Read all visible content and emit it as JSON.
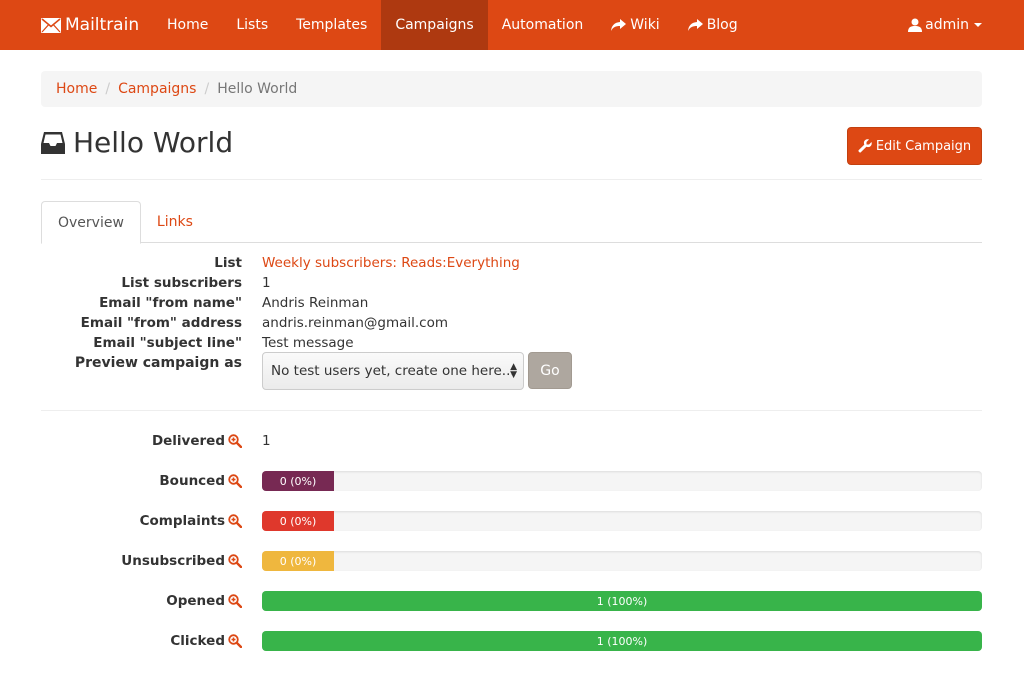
{
  "navbar": {
    "brand": "Mailtrain",
    "items": [
      {
        "label": "Home",
        "active": false,
        "external": false
      },
      {
        "label": "Lists",
        "active": false,
        "external": false
      },
      {
        "label": "Templates",
        "active": false,
        "external": false
      },
      {
        "label": "Campaigns",
        "active": true,
        "external": false
      },
      {
        "label": "Automation",
        "active": false,
        "external": false
      },
      {
        "label": "Wiki",
        "active": false,
        "external": true
      },
      {
        "label": "Blog",
        "active": false,
        "external": true
      }
    ],
    "user": "admin"
  },
  "breadcrumb": {
    "home": "Home",
    "campaigns": "Campaigns",
    "current": "Hello World"
  },
  "header": {
    "title": "Hello World",
    "edit_button": "Edit Campaign"
  },
  "tabs": [
    {
      "label": "Overview",
      "active": true
    },
    {
      "label": "Links",
      "active": false
    }
  ],
  "details": {
    "list_label": "List",
    "list_value": "Weekly subscribers: Reads:Everything",
    "subscribers_label": "List subscribers",
    "subscribers_value": "1",
    "from_name_label": "Email \"from name\"",
    "from_name_value": "Andris Reinman",
    "from_address_label": "Email \"from\" address",
    "from_address_value": "andris.reinman@gmail.com",
    "subject_label": "Email \"subject line\"",
    "subject_value": "Test message",
    "preview_label": "Preview campaign as",
    "preview_select": "No test users yet, create one here...",
    "go_button": "Go"
  },
  "stats": {
    "delivered_label": "Delivered",
    "delivered_value": "1",
    "rows": [
      {
        "label": "Bounced",
        "text": "0 (0%)",
        "fraction": 0,
        "color": "#772953"
      },
      {
        "label": "Complaints",
        "text": "0 (0%)",
        "fraction": 0,
        "color": "#df382c"
      },
      {
        "label": "Unsubscribed",
        "text": "0 (0%)",
        "fraction": 0,
        "color": "#efb73e"
      },
      {
        "label": "Opened",
        "text": "1 (100%)",
        "fraction": 1,
        "color": "#38b44a"
      },
      {
        "label": "Clicked",
        "text": "1 (100%)",
        "fraction": 1,
        "color": "#38b44a"
      }
    ]
  },
  "colors": {
    "brand": "#dd4814",
    "brand_active": "#ae3910",
    "go_button": "#aea79f"
  }
}
